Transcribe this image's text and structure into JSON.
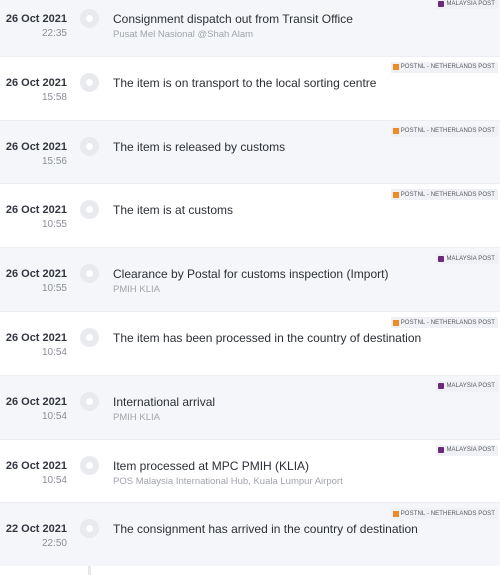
{
  "colors": {
    "malaysia_post": "#6b2a7a",
    "postnl": "#f08a24"
  },
  "events": [
    {
      "date": "26 Oct 2021",
      "time": "22:35",
      "title": "Consignment dispatch out from Transit Office",
      "location": "Pusat Mel Nasional @Shah Alam",
      "carrier": "MALAYSIA POST",
      "carrier_icon": "malaysia-post-logo-icon"
    },
    {
      "date": "26 Oct 2021",
      "time": "15:58",
      "title": "The item is on transport to the local sorting centre",
      "location": "",
      "carrier": "POSTNL - NETHERLANDS POST",
      "carrier_icon": "postnl-logo-icon"
    },
    {
      "date": "26 Oct 2021",
      "time": "15:56",
      "title": "The item is released by customs",
      "location": "",
      "carrier": "POSTNL - NETHERLANDS POST",
      "carrier_icon": "postnl-logo-icon"
    },
    {
      "date": "26 Oct 2021",
      "time": "10:55",
      "title": "The item is at customs",
      "location": "",
      "carrier": "POSTNL - NETHERLANDS POST",
      "carrier_icon": "postnl-logo-icon"
    },
    {
      "date": "26 Oct 2021",
      "time": "10:55",
      "title": "Clearance by Postal for customs inspection (Import)",
      "location": "PMIH KLIA",
      "carrier": "MALAYSIA POST",
      "carrier_icon": "malaysia-post-logo-icon"
    },
    {
      "date": "26 Oct 2021",
      "time": "10:54",
      "title": "The item has been processed in the country of destination",
      "location": "",
      "carrier": "POSTNL - NETHERLANDS POST",
      "carrier_icon": "postnl-logo-icon"
    },
    {
      "date": "26 Oct 2021",
      "time": "10:54",
      "title": "International arrival",
      "location": "PMIH KLIA",
      "carrier": "MALAYSIA POST",
      "carrier_icon": "malaysia-post-logo-icon"
    },
    {
      "date": "26 Oct 2021",
      "time": "10:54",
      "title": "Item processed at MPC PMIH (KLIA)",
      "location": "POS Malaysia International Hub, Kuala Lumpur Airport",
      "carrier": "MALAYSIA POST",
      "carrier_icon": "malaysia-post-logo-icon"
    },
    {
      "date": "22 Oct 2021",
      "time": "22:50",
      "title": "The consignment has arrived in the country of destination",
      "location": "",
      "carrier": "POSTNL - NETHERLANDS POST",
      "carrier_icon": "postnl-logo-icon"
    }
  ]
}
